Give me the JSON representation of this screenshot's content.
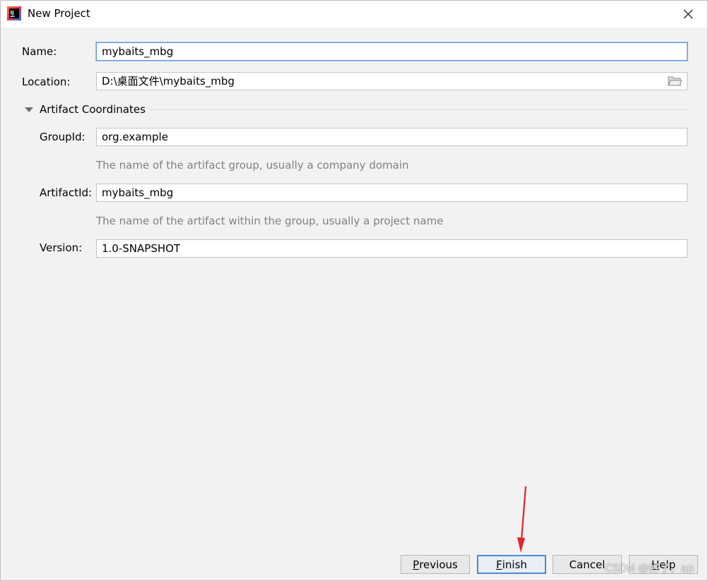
{
  "window": {
    "title": "New Project",
    "app_icon": "intellij-idea-icon",
    "close_icon": "close-icon"
  },
  "form": {
    "name_label": "Name:",
    "name_value": "mybaits_mbg",
    "location_label": "Location:",
    "location_value": "D:\\桌面文件\\mybaits_mbg",
    "folder_icon": "folder-icon",
    "section_title": "Artifact Coordinates",
    "groupid_label": "GroupId:",
    "groupid_value": "org.example",
    "groupid_hint": "The name of the artifact group, usually a company domain",
    "artifactid_label": "ArtifactId:",
    "artifactid_value": "mybaits_mbg",
    "artifactid_hint": "The name of the artifact within the group, usually a project name",
    "version_label": "Version:",
    "version_value": "1.0-SNAPSHOT"
  },
  "buttons": {
    "previous_mnemonic": "P",
    "previous_rest": "revious",
    "finish_mnemonic": "F",
    "finish_rest": "inish",
    "cancel_label": "Cancel",
    "help_mnemonic": "H",
    "help_rest": "elp"
  },
  "annotation": {
    "arrow_color": "#e0242b"
  },
  "watermark": "CSDN @好了，ap",
  "colors": {
    "focus_border": "#5d9ae0",
    "default_button_border": "#4a8bd6",
    "hint_text": "#808080"
  }
}
